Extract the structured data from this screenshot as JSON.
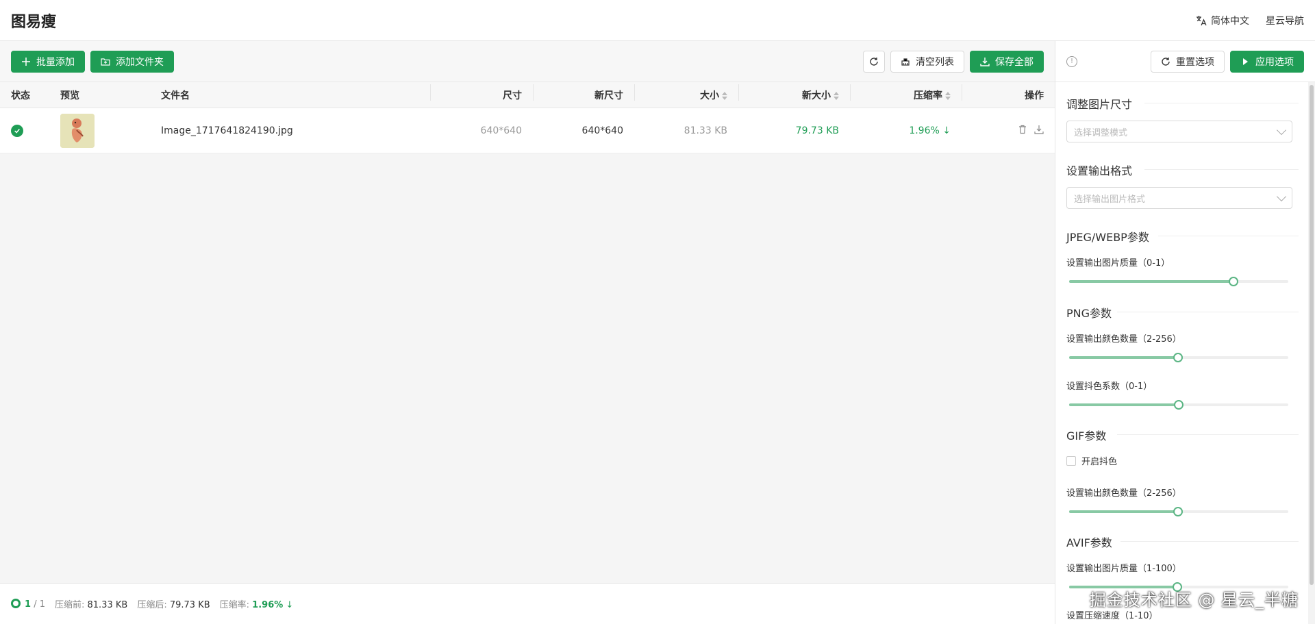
{
  "header": {
    "title": "图易瘦",
    "language": "简体中文",
    "nav": "星云导航"
  },
  "toolbar": {
    "batch_add": "批量添加",
    "add_folder": "添加文件夹",
    "clear_list": "清空列表",
    "save_all": "保存全部"
  },
  "table": {
    "columns": {
      "status": "状态",
      "preview": "预览",
      "filename": "文件名",
      "size": "尺寸",
      "new_size": "新尺寸",
      "bytes": "大小",
      "new_bytes": "新大小",
      "rate": "压缩率",
      "ops": "操作"
    },
    "rows": [
      {
        "status": "done",
        "filename": "Image_1717641824190.jpg",
        "size": "640*640",
        "new_size": "640*640",
        "bytes": "81.33 KB",
        "new_bytes": "79.73 KB",
        "rate": "1.96%"
      }
    ]
  },
  "footer": {
    "done": "1",
    "total": "/ 1",
    "before_label": "压缩前:",
    "before": "81.33 KB",
    "after_label": "压缩后:",
    "after": "79.73 KB",
    "rate_label": "压缩率:",
    "rate": "1.96%"
  },
  "panel": {
    "reset": "重置选项",
    "apply": "应用选项",
    "resize_title": "调整图片尺寸",
    "resize_placeholder": "选择调整模式",
    "format_title": "设置输出格式",
    "format_placeholder": "选择输出图片格式",
    "jpeg_title": "JPEG/WEBP参数",
    "jpeg_quality_label": "设置输出图片质量（0-1）",
    "jpeg_quality": 0.75,
    "png_title": "PNG参数",
    "png_colors_label": "设置输出颜色数量（2-256）",
    "png_colors": 128,
    "png_dither_label": "设置抖色系数（0-1）",
    "png_dither": 0.5,
    "gif_title": "GIF参数",
    "gif_dither_label": "开启抖色",
    "gif_colors_label": "设置输出颜色数量（2-256）",
    "gif_colors": 128,
    "avif_title": "AVIF参数",
    "avif_quality_label": "设置输出图片质量（1-100）",
    "avif_quality": 50,
    "avif_speed_label": "设置压缩速度（1-10）"
  },
  "watermark": "掘金技术社区 @ 星云_半糖",
  "colors": {
    "accent": "#1f9d55"
  }
}
